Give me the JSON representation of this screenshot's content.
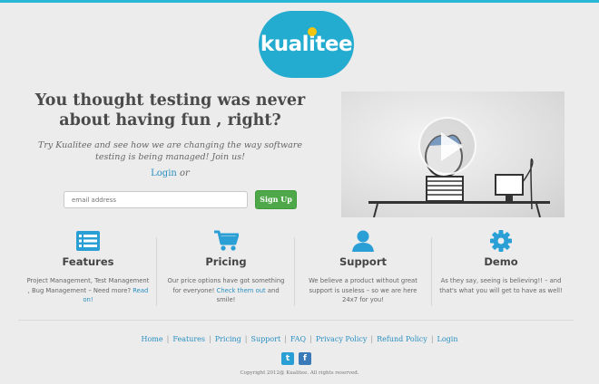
{
  "brand": {
    "logo_text": "kualitee",
    "accent_color": "#24acd0",
    "topbar_color": "#28b5d6"
  },
  "hero": {
    "title": "You thought testing was never about having fun , right?",
    "subtitle": "Try Kualitee and see how we are changing the way software testing is being managed! Join us!",
    "login_link": "Login",
    "login_suffix": "or",
    "email_placeholder": "email address",
    "signup_label": "Sign Up",
    "signup_color": "#4ea84a",
    "video_icon": "play-icon"
  },
  "features": [
    {
      "icon": "list-icon",
      "title": "Features",
      "text": "Project Management, Test Management , Bug Management – Need more?",
      "link": "Read on!"
    },
    {
      "icon": "cart-icon",
      "title": "Pricing",
      "text": "Our price options have got something for everyone!",
      "link": "Check them out",
      "text_after": "and smile!"
    },
    {
      "icon": "user-icon",
      "title": "Support",
      "text": "We believe a product without great support is useless – so we are here 24x7 for you!"
    },
    {
      "icon": "gear-icon",
      "title": "Demo",
      "text": "As they say, seeing is believing!! – and that's what you will get to have as well!"
    }
  ],
  "footer": {
    "nav": [
      "Home",
      "Features",
      "Pricing",
      "Support",
      "FAQ",
      "Privacy Policy",
      "Refund Policy",
      "Login"
    ],
    "social": [
      {
        "icon": "twitter-icon",
        "color": "#2a9fd6"
      },
      {
        "icon": "facebook-icon",
        "color": "#3a7ab8"
      }
    ],
    "copyright": "Copyright 2012@ Kualitee. All rights reserved."
  }
}
